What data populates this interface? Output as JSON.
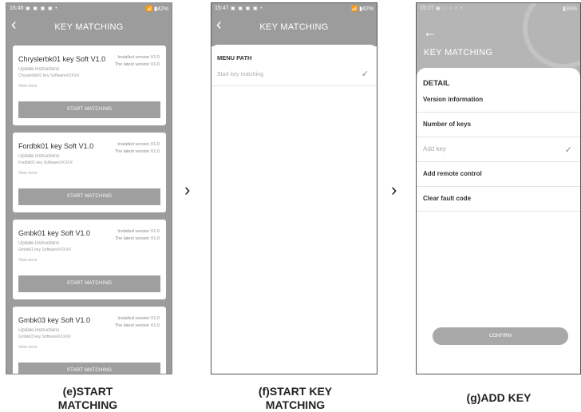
{
  "screen_e": {
    "status": {
      "time": "15:46",
      "icons": "▣ ▣ ▣ ▣ •",
      "battery": "📶 ▮42%"
    },
    "title": "KEY MATCHING",
    "cards": [
      {
        "name": "Chryslerbk01 key Soft",
        "version": "V1.0",
        "installed": "Installed version  V1.0",
        "latest": "The latest version  V1.0",
        "update": "Update instructions",
        "desc": "Chryslerbk01 key SoftwareXXXXX",
        "more": "View more",
        "button": "START MATCHING"
      },
      {
        "name": "Fordbk01 key Soft",
        "version": "V1.0",
        "installed": "Installed version  V1.0",
        "latest": "The latest version  V1.0",
        "update": "Update instructions",
        "desc": "Fordbk01 key SoftwareXXXXX",
        "more": "View more",
        "button": "START MATCHING"
      },
      {
        "name": "Gmbk01 key Soft",
        "version": "V1.0",
        "installed": "Installed version  V1.0",
        "latest": "The latest version  V1.0",
        "update": "Update instructions",
        "desc": "Gmbk01 key SoftwareXXXXX",
        "more": "View more",
        "button": "START MATCHING"
      },
      {
        "name": "Gmbk03 key Soft",
        "version": "V1.0",
        "installed": "Installed version  V1.0",
        "latest": "The latest version  V1.0",
        "update": "Update instructions",
        "desc": "Gmbk03 key SoftwareXXXXX",
        "more": "View more",
        "button": "START MATCHING"
      }
    ],
    "caption": "(e)START\nMATCHING"
  },
  "screen_f": {
    "status": {
      "time": "15:47",
      "icons": "▣ ▣ ▣ ▣ •",
      "battery": "📶 ▮42%"
    },
    "title": "KEY MATCHING",
    "menu_path": "MENU PATH",
    "item": "Start key matching",
    "caption": "(f)START KEY\nMATCHING"
  },
  "screen_g": {
    "status": {
      "time": "15:27",
      "icons": "▣ ○ ○ ○ •",
      "battery": "▮39%"
    },
    "title": "KEY MATCHING",
    "detail": "DETAIL",
    "rows": [
      "Version information",
      "Number of keys",
      "Add key",
      "Add remote control",
      "Clear fault code"
    ],
    "confirm": "CONFIRM",
    "caption": "(g)ADD KEY"
  },
  "icons": {
    "back": "back-arrow-icon",
    "check": "check-icon",
    "next": "chevron-right-icon"
  },
  "colors": {
    "primary_gray": "#9c9c9c",
    "card_bg": "#ffffff"
  }
}
